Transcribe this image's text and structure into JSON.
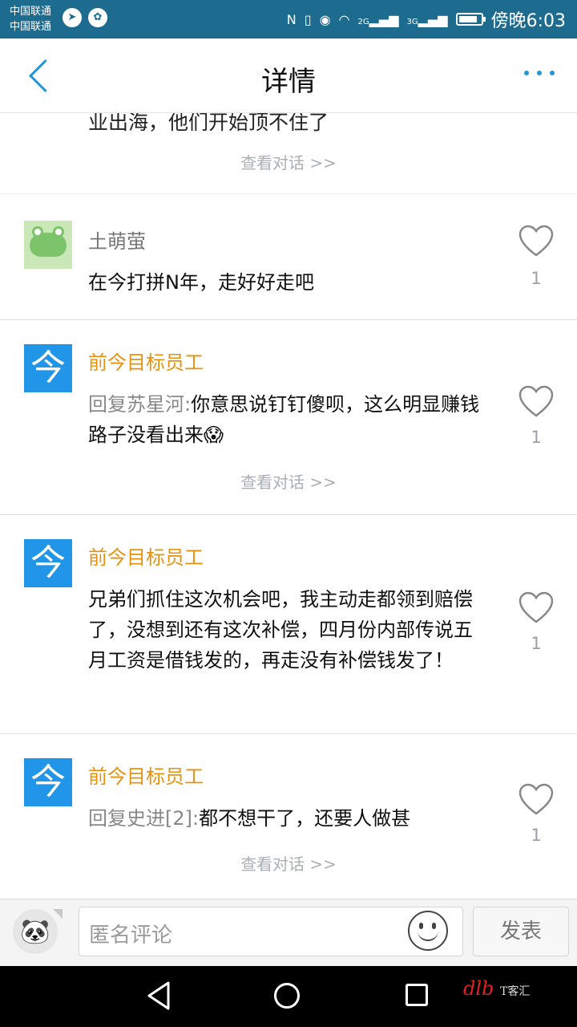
{
  "status_bar": {
    "carrier1": "中国联通",
    "carrier2": "中国联通",
    "nfc": "N",
    "net_2g": "2G",
    "net_3g": "3G",
    "time": "傍晚6:03",
    "battery_level": 0.85
  },
  "header": {
    "title": "详情"
  },
  "partial_text": "业出海，他们开始顶不住了",
  "comments": [
    {
      "author": "土萌萤",
      "text": "在今打拼N年，走好好走吧",
      "likes": "1"
    },
    {
      "author": "前今目标员工",
      "reply_prefix": "回复苏星河:",
      "text": "你意思说钉钉傻呗，这么明显赚钱路子没看出来😱",
      "likes": "1",
      "view_conversation": "查看对话 >>"
    },
    {
      "author": "前今目标员工",
      "text": "兄弟们抓住这次机会吧，我主动走都领到赔偿了，没想到还有这次补偿，四月份内部传说五月工资是借钱发的，再走没有补偿钱发了！",
      "likes": "1"
    },
    {
      "author": "前今目标员工",
      "reply_prefix": "回复史进[2]:",
      "text": "都不想干了，还要人做甚",
      "likes": "1",
      "view_conversation": "查看对话 >>"
    }
  ],
  "first_view_conversation": "查看对话 >>",
  "avatar_glyph": "今",
  "bottom_bar": {
    "placeholder": "匿名评论",
    "post_label": "发表"
  },
  "watermark": {
    "logo": "dlb",
    "text": "T客汇"
  },
  "colors": {
    "status_bar": "#1d6b8e",
    "accent": "#2196d6",
    "author_orange": "#e5920f"
  }
}
